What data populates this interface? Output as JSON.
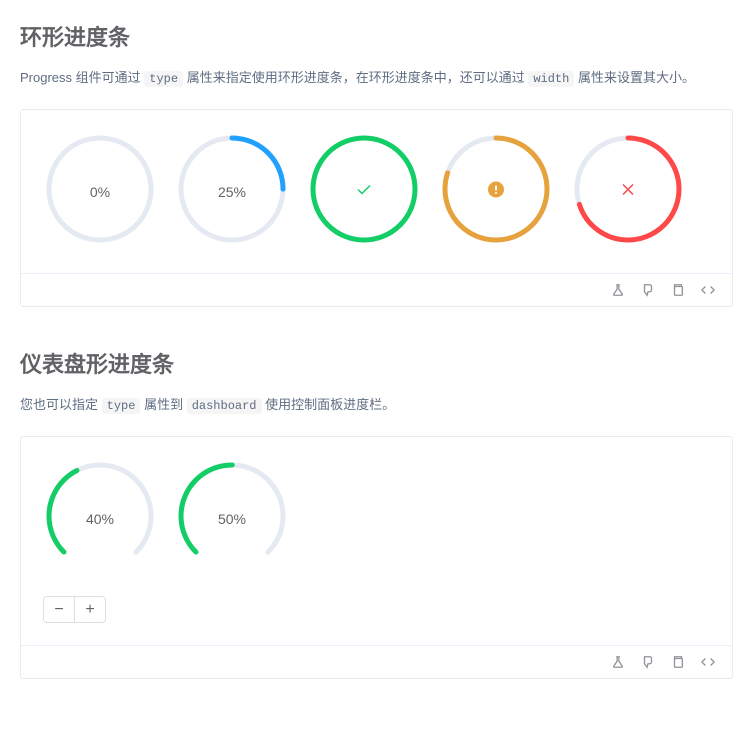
{
  "section1": {
    "title": "环形进度条",
    "desc_parts": [
      "Progress 组件可通过 ",
      " 属性来指定使用环形进度条，在环形进度条中，还可以通过 ",
      " 属性来设置其大小。"
    ],
    "code1": "type",
    "code2": "width"
  },
  "section2": {
    "title": "仪表盘形进度条",
    "desc_parts": [
      "您也可以指定 ",
      " 属性到 ",
      " 使用控制面板进度栏。"
    ],
    "code1": "type",
    "code2": "dashboard"
  },
  "chart_data": [
    {
      "type": "pie",
      "title": "circle-progress-row",
      "series": [
        {
          "name": "progress-0",
          "value": 0,
          "status": "default",
          "label": "0%"
        },
        {
          "name": "progress-25",
          "value": 25,
          "status": "default",
          "label": "25%"
        },
        {
          "name": "progress-100-success",
          "value": 100,
          "status": "success",
          "label": "✓"
        },
        {
          "name": "progress-80-warning",
          "value": 80,
          "status": "warning",
          "label": "!"
        },
        {
          "name": "progress-70-exception",
          "value": 70,
          "status": "exception",
          "label": "✕"
        }
      ],
      "colors": {
        "default": "#20a0ff",
        "success": "#13ce66",
        "warning": "#e6a23c",
        "exception": "#ff4949",
        "track": "#e5e9f2"
      },
      "diameter": 114
    },
    {
      "type": "pie",
      "title": "dashboard-progress-row",
      "series": [
        {
          "name": "dashboard-40",
          "value": 40,
          "status": "success",
          "label": "40%"
        },
        {
          "name": "dashboard-50",
          "value": 50,
          "status": "success",
          "label": "50%"
        }
      ],
      "colors": {
        "success": "#13ce66",
        "track": "#e5e9f2"
      },
      "diameter": 114,
      "arc_percent": 75
    }
  ],
  "buttons": {
    "minus": "−",
    "plus": "+"
  }
}
